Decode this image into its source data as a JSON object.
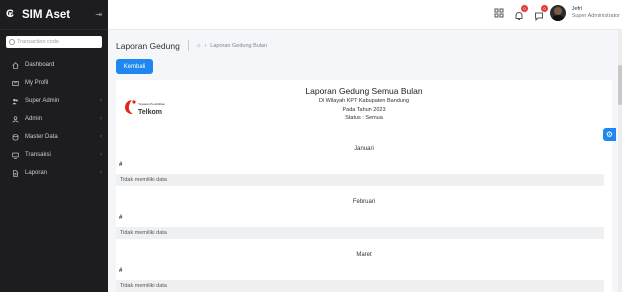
{
  "app": {
    "name": "SIM Aset"
  },
  "search": {
    "placeholder": "Transaction code"
  },
  "sidebar": {
    "items": [
      {
        "label": "Dashboard",
        "icon": "home-icon"
      },
      {
        "label": "My Profil",
        "icon": "id-card-icon"
      },
      {
        "label": "Super Admin",
        "icon": "users-icon"
      },
      {
        "label": "Admin",
        "icon": "user-icon"
      },
      {
        "label": "Master Data",
        "icon": "database-icon"
      },
      {
        "label": "Transaksi",
        "icon": "monitor-icon"
      },
      {
        "label": "Laporan",
        "icon": "document-icon"
      }
    ]
  },
  "header": {
    "notifications": [
      {
        "icon": "grid-icon"
      },
      {
        "icon": "bell-icon",
        "badge": "0"
      },
      {
        "icon": "chat-icon",
        "badge": "0"
      }
    ],
    "user": {
      "name": "Jefri",
      "role": "Super Administrator"
    }
  },
  "page": {
    "title": "Laporan Gedung",
    "breadcrumb": "Laporan Gedung Bulan",
    "back_button": "Kembali"
  },
  "report": {
    "logo_small": "Yayasan Pendidikan",
    "logo_big": "Telkom",
    "title": "Laporan Gedung Semua Bulan",
    "region": "Di Wilayah KPT Kabupaten Bandung",
    "year": "Pada Tahun 2023",
    "status": "Status : Semua",
    "months": [
      {
        "name": "Januari",
        "col": "#",
        "empty": "Tidak memiliki data"
      },
      {
        "name": "Februari",
        "col": "#",
        "empty": "Tidak memiliki data"
      },
      {
        "name": "Maret",
        "col": "#",
        "empty": "Tidak memiliki data"
      }
    ]
  },
  "colors": {
    "primary": "#1e88f0",
    "sidebar": "#1d1d1f",
    "badge": "#e53935"
  }
}
